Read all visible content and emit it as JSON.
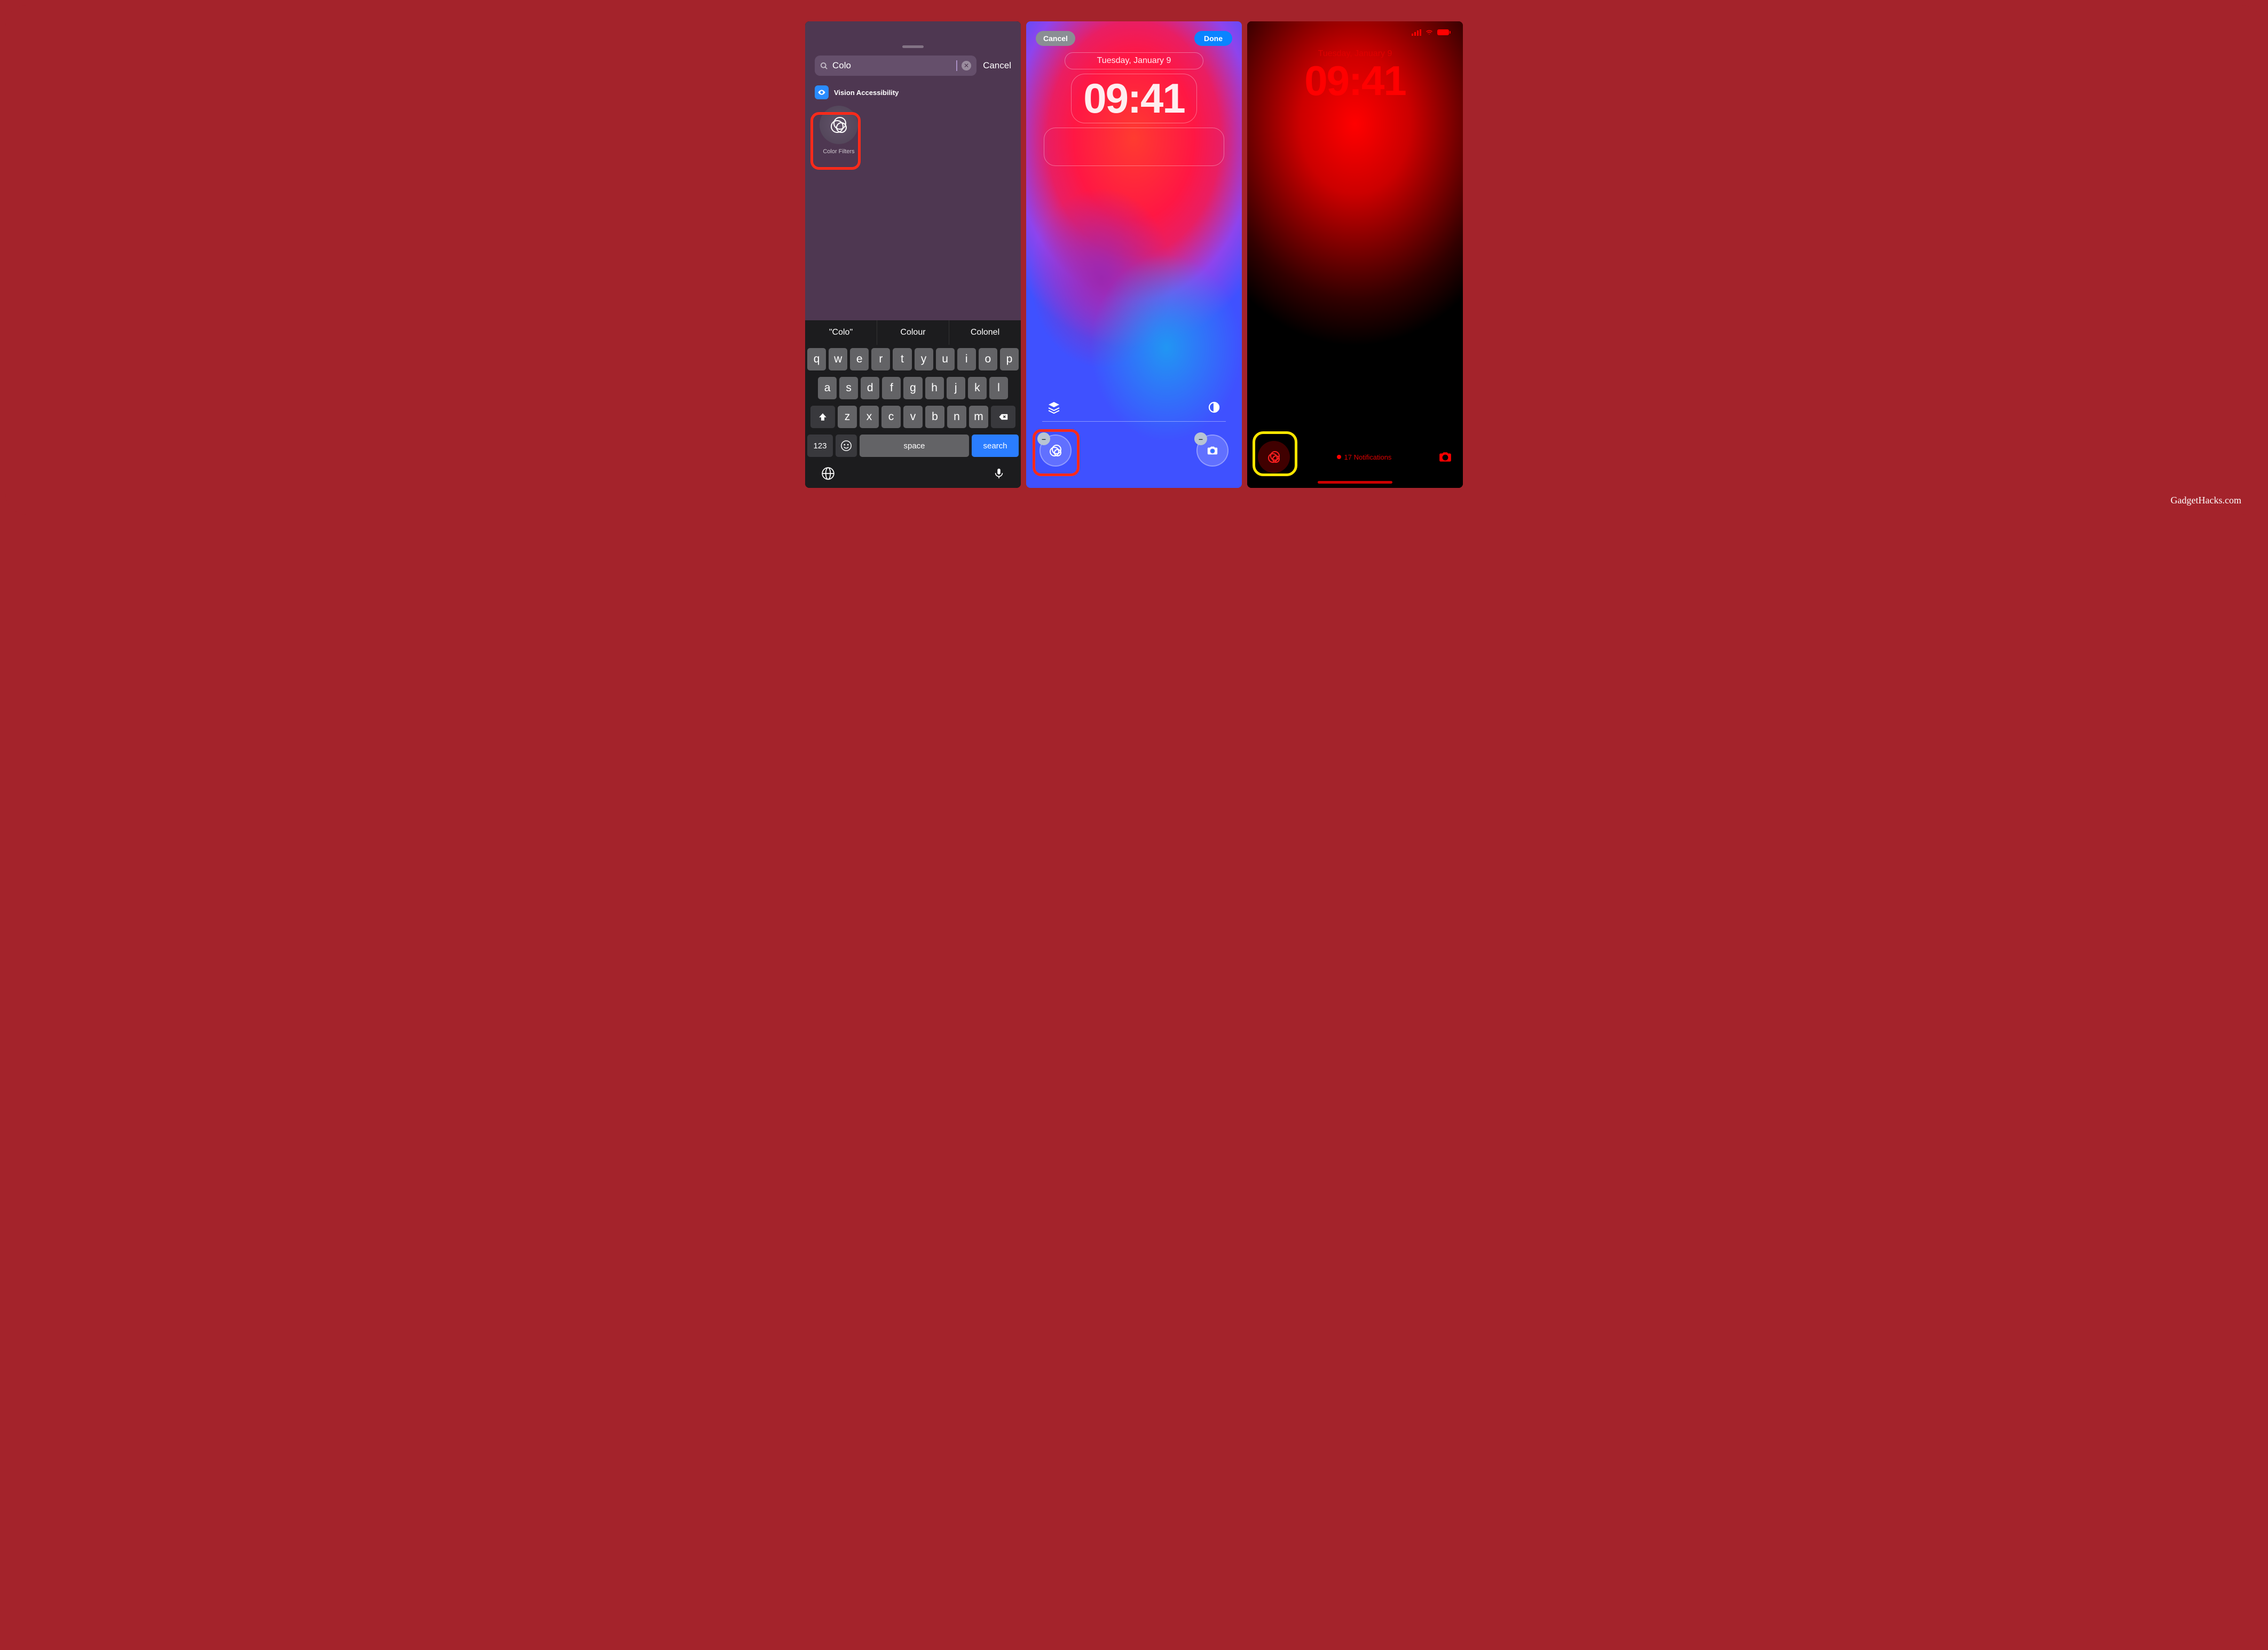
{
  "attribution": "GadgetHacks.com",
  "screen1": {
    "search": {
      "query": "Colo",
      "cancel": "Cancel"
    },
    "section": {
      "title": "Vision Accessibility"
    },
    "widget": {
      "label": "Color Filters"
    },
    "suggestions": [
      "\"Colo\"",
      "Colour",
      "Colonel"
    ],
    "keys": {
      "row1": [
        "q",
        "w",
        "e",
        "r",
        "t",
        "y",
        "u",
        "i",
        "o",
        "p"
      ],
      "row2": [
        "a",
        "s",
        "d",
        "f",
        "g",
        "h",
        "j",
        "k",
        "l"
      ],
      "row3": [
        "z",
        "x",
        "c",
        "v",
        "b",
        "n",
        "m"
      ],
      "n123": "123",
      "space": "space",
      "search": "search"
    }
  },
  "screen2": {
    "cancel": "Cancel",
    "done": "Done",
    "date": "Tuesday, January 9",
    "time": "09:41",
    "minus": "–"
  },
  "screen3": {
    "date": "Tuesday, January 9",
    "time": "09:41",
    "notifications": "17 Notifications"
  }
}
